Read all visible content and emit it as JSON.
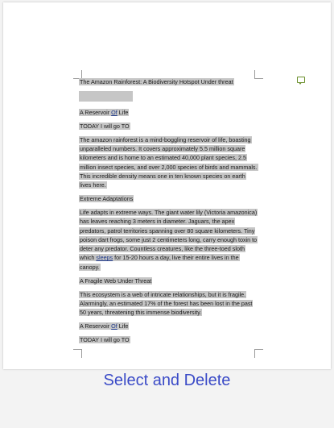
{
  "document": {
    "title": "The Amazon Rainforest: A Biodiversity Hotspot Under threat",
    "heading1_pre": "A Reservoir ",
    "heading1_link": "Of",
    "heading1_post": " Life",
    "today1": "TODAY I will go TO",
    "para1": "The amazon rainforest is a mind-boggling reservoir of life, boasting unparalleled numbers. It covers approximately 5.5 million square kilometers and is home to an estimated 40,000 plant species, 2.5 million insect species, and over 2,000 species of birds and mammals. This incredible density means one in ten known species on earth lives here.",
    "heading2": "Extreme Adaptations",
    "para2_pre": "Life adapts in extreme ways. The giant water lily (Victoria amazonica) has leaves reaching 3 meters in diameter. Jaguars, the apex predators, patrol territories spanning over 80 square kilometers. Tiny poison dart frogs, some just 2 centimeters long, carry enough toxin to deter any predator. Countless creatures, like the three-toed sloth which ",
    "para2_link": "sleeps",
    "para2_post": " for 15-20 hours a day, live their entire lives in the canopy.",
    "heading3": "A Fragile Web Under Threat",
    "para3": "This ecosystem is a web of intricate relationships, but it is fragile. Alarmingly, an estimated 17% of the forest has been lost in the past 50 years, threatening this immense biodiversity.",
    "heading4_pre": "A Reservoir ",
    "heading4_link": "Of",
    "heading4_post": " Life",
    "today2": "TODAY I will go TO"
  },
  "caption": "Select and Delete",
  "colors": {
    "selection": "#c6c6c6",
    "caption": "#3b4bc7",
    "link": "#1f3a8a"
  }
}
